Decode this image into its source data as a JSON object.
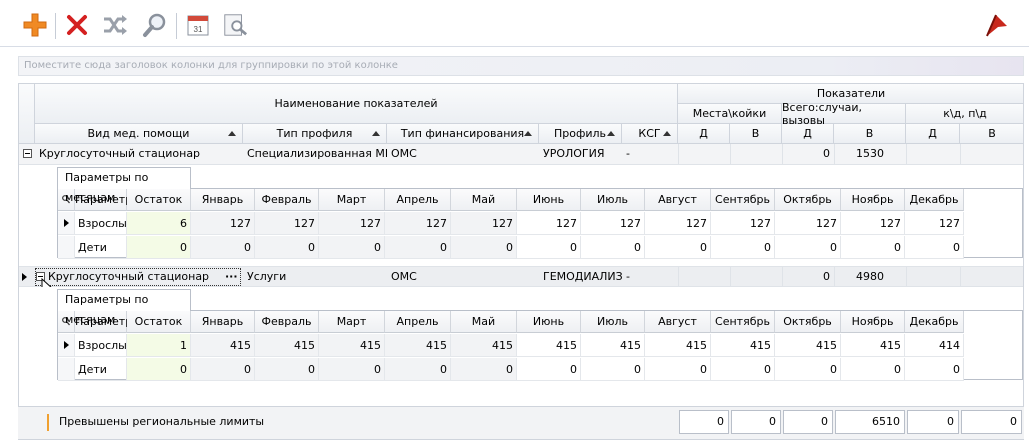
{
  "toolbar": {
    "buttons": [
      "add-icon",
      "delete-icon",
      "shuffle-icon",
      "search-icon",
      "calendar-icon",
      "preview-icon"
    ],
    "calendar_day": "31",
    "right_icon": "red-flag-icon"
  },
  "group_panel": {
    "text": "Поместите сюда заголовок колонки для группировки по этой колонке"
  },
  "headers": {
    "main_group": "Наименование показателей",
    "indicators_group": "Показатели",
    "places": "Места\\койки",
    "total_cases": "Всего:случаи, вызовы",
    "kd": "к\\д, п\\д",
    "vid": "Вид мед. помощи",
    "profile_type": "Тип профиля",
    "finance": "Тип финансирования",
    "profile": "Профиль",
    "ksg": "КСГ",
    "d1": "Д",
    "v1": "В",
    "d2": "Д",
    "v2": "В",
    "d3": "Д",
    "v3": "В"
  },
  "groups": [
    {
      "vid": "Круглосуточный стационар",
      "profile_type": "Специализированная МП",
      "finance": "ОМС",
      "profile": "УРОЛОГИЯ",
      "ksg": "-",
      "total_d": "0",
      "total_v": "1530",
      "detail": {
        "tab": "Параметры по месяцам",
        "columns": [
          "Параметр",
          "Остаток",
          "Январь",
          "Февраль",
          "Март",
          "Апрель",
          "Май",
          "Июнь",
          "Июль",
          "Август",
          "Сентябрь",
          "Октябрь",
          "Ноябрь",
          "Декабрь"
        ],
        "rows": [
          {
            "name": "Взрослые",
            "values": [
              "6",
              "127",
              "127",
              "127",
              "127",
              "127",
              "127",
              "127",
              "127",
              "127",
              "127",
              "127",
              "127"
            ]
          },
          {
            "name": "Дети",
            "values": [
              "0",
              "0",
              "0",
              "0",
              "0",
              "0",
              "0",
              "0",
              "0",
              "0",
              "0",
              "0",
              "0"
            ]
          }
        ]
      }
    },
    {
      "vid": "Круглосуточный стационар",
      "profile_type": "Услуги",
      "finance": "ОМС",
      "profile": "ГЕМОДИАЛИЗ",
      "ksg": "-",
      "total_d": "0",
      "total_v": "4980",
      "detail": {
        "tab": "Параметры по месяцам",
        "columns": [
          "Параметр",
          "Остаток",
          "Январь",
          "Февраль",
          "Март",
          "Апрель",
          "Май",
          "Июнь",
          "Июль",
          "Август",
          "Сентябрь",
          "Октябрь",
          "Ноябрь",
          "Декабрь"
        ],
        "rows": [
          {
            "name": "Взрослые",
            "values": [
              "1",
              "415",
              "415",
              "415",
              "415",
              "415",
              "415",
              "415",
              "415",
              "415",
              "415",
              "415",
              "414"
            ]
          },
          {
            "name": "Дети",
            "values": [
              "0",
              "0",
              "0",
              "0",
              "0",
              "0",
              "0",
              "0",
              "0",
              "0",
              "0",
              "0",
              "0"
            ]
          }
        ]
      }
    }
  ],
  "ellipsis": "···",
  "footer": {
    "legend": "Превышены региональные лимиты",
    "totals": [
      "0",
      "0",
      "0",
      "6510",
      "0",
      "0"
    ]
  },
  "colors": {
    "accent_orange": "#f08a24",
    "warning_bar": "#f0a030",
    "remainder_bg": "#f4fbe6",
    "delete_red": "#d42020"
  }
}
